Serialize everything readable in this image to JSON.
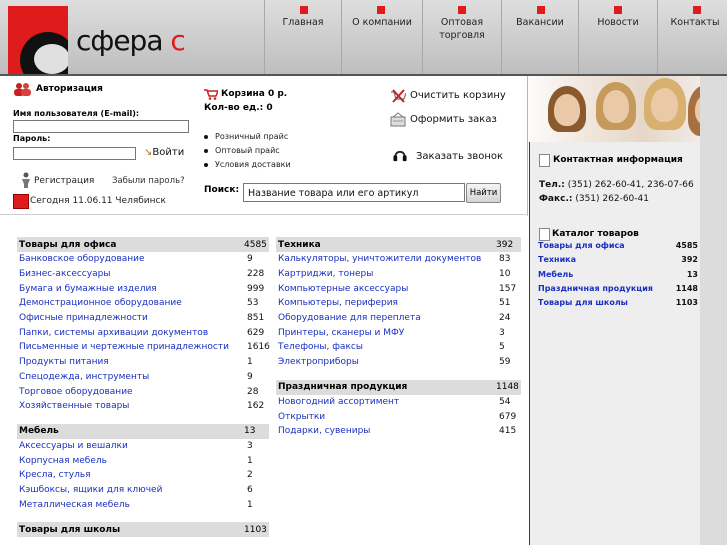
{
  "logo": {
    "text": "сфера",
    "letter": "с"
  },
  "nav": [
    {
      "label": "Главная"
    },
    {
      "label": "О компании"
    },
    {
      "label": "Оптовая торговля"
    },
    {
      "label": "Вакансии"
    },
    {
      "label": "Новости"
    },
    {
      "label": "Контакты"
    }
  ],
  "auth": {
    "title": "Авторизация",
    "user_label": "Имя пользователя (E-mail):",
    "password_label": "Пароль:",
    "login_button": "Войти",
    "register": "Регистрация",
    "forgot": "Забыли пароль?",
    "today": "Сегодня 11.06.11 Челябинск"
  },
  "cart": {
    "line1": "Корзина 0 р.",
    "line2": "Кол-во ед.: 0",
    "clear": "Очистить корзину",
    "order": "Оформить заказ",
    "call": "Заказать звонок",
    "price_links": [
      "Розничный прайс",
      "Оптовый прайс",
      "Условия доставки"
    ]
  },
  "search": {
    "label": "Поиск:",
    "placeholder": "Название товара или его артикул",
    "button": "Найти"
  },
  "contacts": {
    "title": "Контактная информация",
    "tel_label": "Тел.:",
    "tel": "(351) 262-60-41, 236-07-66",
    "fax_label": "Факс.:",
    "fax": "(351) 262-60-41"
  },
  "catalog_side": {
    "title": "Каталог товаров",
    "items": [
      {
        "name": "Товары для офиса",
        "count": "4585"
      },
      {
        "name": "Техника",
        "count": "392"
      },
      {
        "name": "Мебель",
        "count": "13"
      },
      {
        "name": "Праздничная продукция",
        "count": "1148"
      },
      {
        "name": "Товары для школы",
        "count": "1103"
      }
    ]
  },
  "catalog_left": [
    {
      "title": "Товары для офиса",
      "count": "4585",
      "items": [
        {
          "name": "Банковское оборудование",
          "count": "9"
        },
        {
          "name": "Бизнес-аксессуары",
          "count": "228"
        },
        {
          "name": "Бумага и бумажные изделия",
          "count": "999"
        },
        {
          "name": "Демонстрационное оборудование",
          "count": "53"
        },
        {
          "name": "Офисные принадлежности",
          "count": "851"
        },
        {
          "name": "Папки, системы архивации документов",
          "count": "629"
        },
        {
          "name": "Письменные и чертежные принадлежности",
          "count": "1616"
        },
        {
          "name": "Продукты питания",
          "count": "1"
        },
        {
          "name": "Спецодежда, инструменты",
          "count": "9"
        },
        {
          "name": "Торговое оборудование",
          "count": "28"
        },
        {
          "name": "Хозяйственные товары",
          "count": "162"
        }
      ]
    },
    {
      "title": "Мебель",
      "count": "13",
      "items": [
        {
          "name": "Аксессуары и вешалки",
          "count": "3"
        },
        {
          "name": "Корпусная мебель",
          "count": "1"
        },
        {
          "name": "Кресла, стулья",
          "count": "2"
        },
        {
          "name": "Кэшбоксы, ящики для ключей",
          "count": "6"
        },
        {
          "name": "Металлическая мебель",
          "count": "1"
        }
      ]
    },
    {
      "title": "Товары для школы",
      "count": "1103",
      "items": []
    }
  ],
  "catalog_right": [
    {
      "title": "Техника",
      "count": "392",
      "items": [
        {
          "name": "Калькуляторы, уничтожители документов",
          "count": "83"
        },
        {
          "name": "Картриджи, тонеры",
          "count": "10"
        },
        {
          "name": "Компьютерные аксессуары",
          "count": "157"
        },
        {
          "name": "Компьютеры, периферия",
          "count": "51"
        },
        {
          "name": "Оборудование для переплета",
          "count": "24"
        },
        {
          "name": "Принтеры, сканеры и МФУ",
          "count": "3"
        },
        {
          "name": "Телефоны, факсы",
          "count": "5"
        },
        {
          "name": "Электроприборы",
          "count": "59"
        }
      ]
    },
    {
      "title": "Праздничная продукция",
      "count": "1148",
      "items": [
        {
          "name": "Новогодний ассортимент",
          "count": "54"
        },
        {
          "name": "Открытки",
          "count": "679"
        },
        {
          "name": "Подарки, сувениры",
          "count": "415"
        }
      ]
    }
  ]
}
